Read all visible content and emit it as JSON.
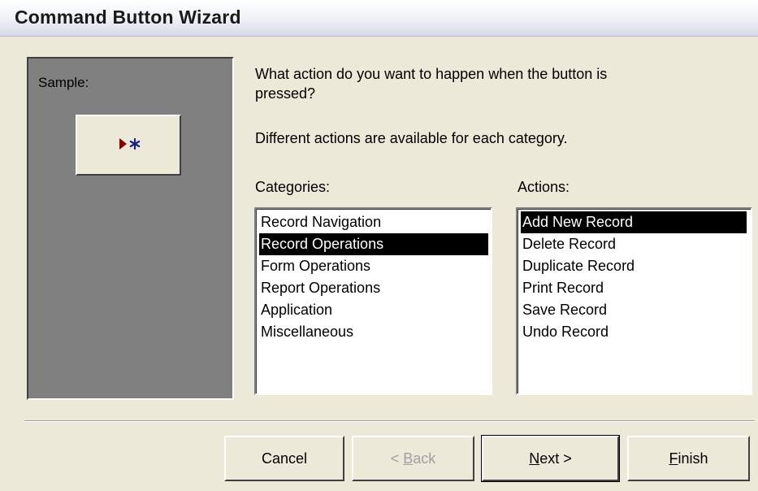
{
  "window": {
    "title": "Command Button Wizard"
  },
  "sample": {
    "label": "Sample:",
    "button_icon": "new-record-arrow-asterisk-icon"
  },
  "prompt": {
    "question_line1": "What action do you want to happen when the button is",
    "question_line2": "pressed?",
    "info": "Different actions are available for each category."
  },
  "categories": {
    "label": "Categories:",
    "items": [
      "Record Navigation",
      "Record Operations",
      "Form Operations",
      "Report Operations",
      "Application",
      "Miscellaneous"
    ],
    "selected": "Record Operations"
  },
  "actions": {
    "label": "Actions:",
    "items": [
      "Add New Record",
      "Delete Record",
      "Duplicate Record",
      "Print Record",
      "Save Record",
      "Undo Record"
    ],
    "selected": "Add New Record"
  },
  "buttons": {
    "cancel": "Cancel",
    "back_prefix": "< ",
    "back_mnemonic": "B",
    "back_rest": "ack",
    "next_mnemonic": "N",
    "next_rest": "ext >",
    "finish_mnemonic": "F",
    "finish_rest": "inish"
  },
  "colors": {
    "dialog_bg": "#ece9d8",
    "sample_bg": "#808080",
    "selection_bg": "#000000",
    "selection_fg": "#ffffff",
    "icon_arrow": "#8b0000",
    "icon_asterisk": "#1a237e",
    "disabled_text": "#a0a0a0"
  }
}
